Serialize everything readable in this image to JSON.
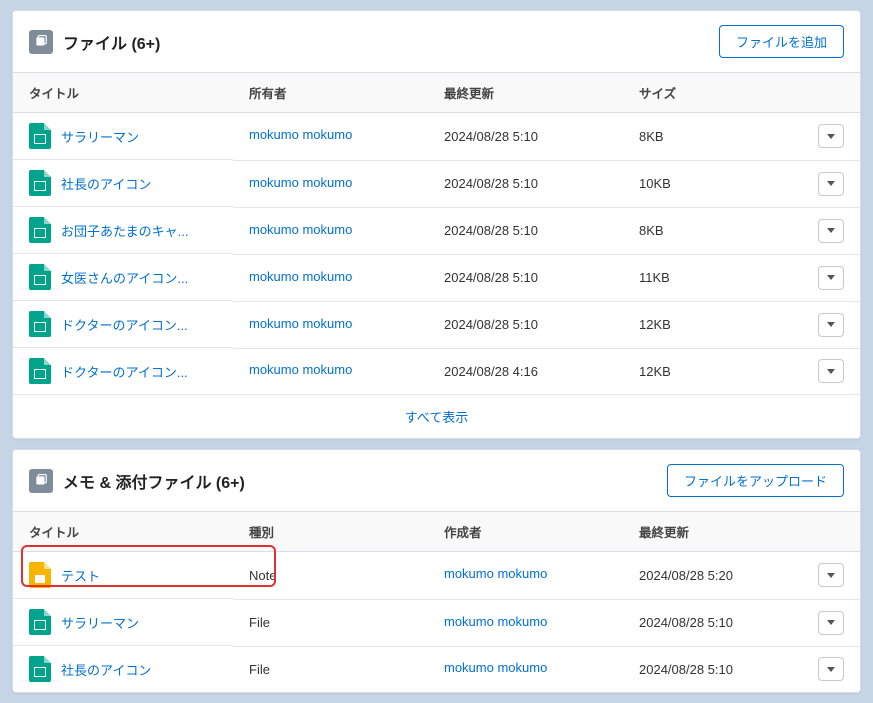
{
  "files": {
    "title": "ファイル (6+)",
    "button": "ファイルを追加",
    "columns": {
      "c1": "タイトル",
      "c2": "所有者",
      "c3": "最終更新",
      "c4": "サイズ"
    },
    "rows": [
      {
        "title": "サラリーマン",
        "owner": "mokumo mokumo",
        "updated": "2024/08/28 5:10",
        "size": "8KB"
      },
      {
        "title": "社長のアイコン",
        "owner": "mokumo mokumo",
        "updated": "2024/08/28 5:10",
        "size": "10KB"
      },
      {
        "title": "お団子あたまのキャ...",
        "owner": "mokumo mokumo",
        "updated": "2024/08/28 5:10",
        "size": "8KB"
      },
      {
        "title": "女医さんのアイコン...",
        "owner": "mokumo mokumo",
        "updated": "2024/08/28 5:10",
        "size": "11KB"
      },
      {
        "title": "ドクターのアイコン...",
        "owner": "mokumo mokumo",
        "updated": "2024/08/28 5:10",
        "size": "12KB"
      },
      {
        "title": "ドクターのアイコン...",
        "owner": "mokumo mokumo",
        "updated": "2024/08/28 4:16",
        "size": "12KB"
      }
    ],
    "showAll": "すべて表示"
  },
  "notes": {
    "title": "メモ & 添付ファイル (6+)",
    "button": "ファイルをアップロード",
    "columns": {
      "c1": "タイトル",
      "c2": "種別",
      "c3": "作成者",
      "c4": "最終更新"
    },
    "rows": [
      {
        "title": "テスト",
        "type": "Note",
        "creator": "mokumo mokumo",
        "updated": "2024/08/28 5:20",
        "iconColor": "yellow"
      },
      {
        "title": "サラリーマン",
        "type": "File",
        "creator": "mokumo mokumo",
        "updated": "2024/08/28 5:10",
        "iconColor": "green"
      },
      {
        "title": "社長のアイコン",
        "type": "File",
        "creator": "mokumo mokumo",
        "updated": "2024/08/28 5:10",
        "iconColor": "green"
      }
    ]
  }
}
